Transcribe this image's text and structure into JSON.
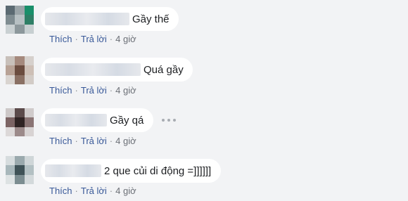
{
  "comments": [
    {
      "text": "Gầy thế",
      "actions": {
        "like": "Thích",
        "reply": "Trả lời",
        "time": "4 giờ"
      },
      "colors": [
        "#5b6a72",
        "#9aa4a8",
        "#1a8f6a",
        "#7f8c91",
        "#b7c0c3",
        "#2f7f66",
        "#c9d0d2",
        "#8d989c",
        "#c7cfd1"
      ]
    },
    {
      "text": "Quá gầy",
      "actions": {
        "like": "Thích",
        "reply": "Trả lời",
        "time": "4 giờ"
      },
      "colors": [
        "#c8c0ba",
        "#a5897d",
        "#d6d0cc",
        "#b8a296",
        "#6b4c3f",
        "#cdbfb6",
        "#d9d4d0",
        "#8a7064",
        "#d2cbc6"
      ]
    },
    {
      "text": "Gầy qá",
      "actions": {
        "like": "Thích",
        "reply": "Trả lời",
        "time": "4 giờ"
      },
      "colors": [
        "#cdc8c8",
        "#5b4a4a",
        "#d0cbcb",
        "#7c6464",
        "#2f2323",
        "#8a7474",
        "#dcd8d8",
        "#9c8a8a",
        "#d8d3d3"
      ]
    },
    {
      "text": "2 que củi di động =]]]]]]",
      "actions": {
        "like": "Thích",
        "reply": "Trả lời",
        "time": "4 giờ"
      },
      "colors": [
        "#d6dcde",
        "#9aa9ad",
        "#cfd6d8",
        "#a8b7bb",
        "#3f5257",
        "#b3c0c3",
        "#dde2e3",
        "#7c8d91",
        "#d3d9db"
      ]
    }
  ]
}
